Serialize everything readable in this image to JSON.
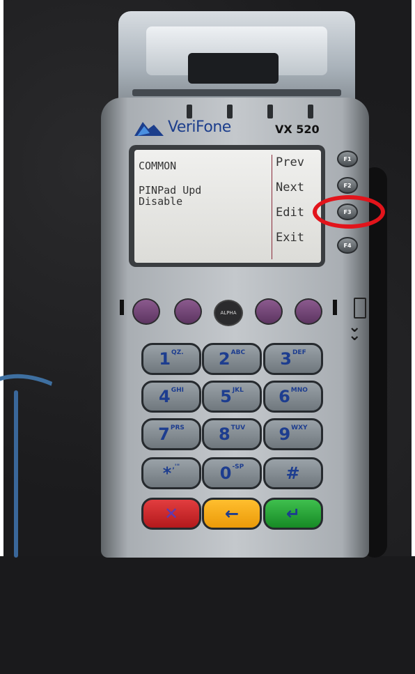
{
  "device": {
    "brand": "VeriFone",
    "model": "VX 520"
  },
  "screen": {
    "header": "COMMON",
    "setting_name": "PINPad Upd",
    "setting_value": "Disable",
    "softkeys": [
      "Prev",
      "Next",
      "Edit",
      "Exit"
    ]
  },
  "function_keys": [
    "F1",
    "F2",
    "F3",
    "F4"
  ],
  "highlighted_key": "F3",
  "highlight_color": "#e2141b",
  "alpha_key": "ALPHA",
  "keypad": [
    {
      "digit": "1",
      "letters": "QZ."
    },
    {
      "digit": "2",
      "letters": "ABC"
    },
    {
      "digit": "3",
      "letters": "DEF"
    },
    {
      "digit": "4",
      "letters": "GHI"
    },
    {
      "digit": "5",
      "letters": "JKL"
    },
    {
      "digit": "6",
      "letters": "MNO"
    },
    {
      "digit": "7",
      "letters": "PRS"
    },
    {
      "digit": "8",
      "letters": "TUV"
    },
    {
      "digit": "9",
      "letters": "WXY"
    },
    {
      "digit": "*",
      "letters": ",'\""
    },
    {
      "digit": "0",
      "letters": "-SP"
    },
    {
      "digit": "#",
      "letters": ""
    }
  ],
  "bottom_keys": [
    {
      "name": "cancel",
      "glyph": "✕",
      "color": "#d12a2c"
    },
    {
      "name": "clear",
      "glyph": "←",
      "color": "#f5ab18"
    },
    {
      "name": "enter",
      "glyph": "↵",
      "color": "#2aa63a"
    }
  ]
}
